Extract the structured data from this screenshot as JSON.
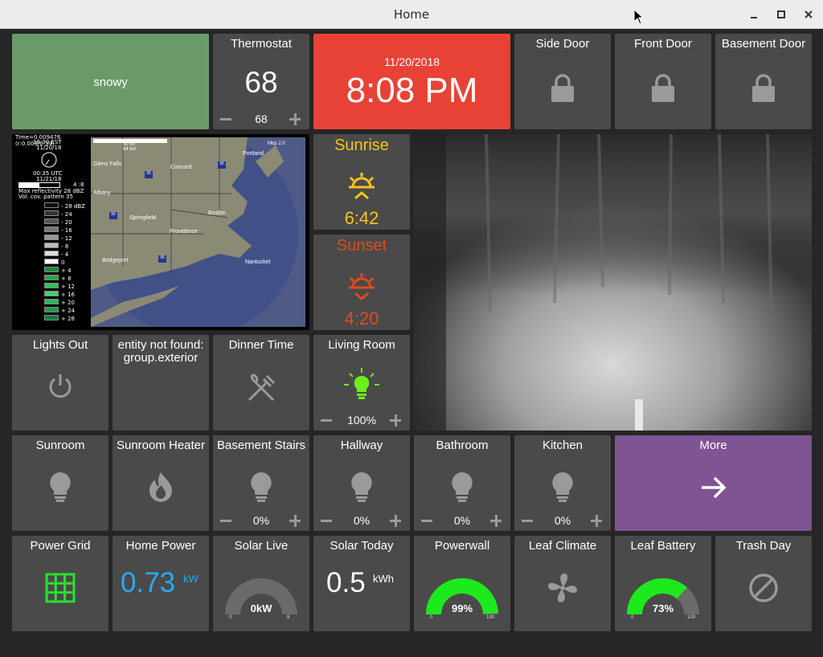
{
  "window": {
    "title": "Home"
  },
  "tiles": {
    "weather": {
      "label": "snowy",
      "color": "#6a9a6a"
    },
    "thermostat": {
      "title": "Thermostat",
      "value": "68",
      "setpoint": "68"
    },
    "clock": {
      "date": "11/20/2018",
      "time": "8:08 PM",
      "color": "#e84236"
    },
    "side_door": {
      "title": "Side Door",
      "icon": "lock-icon"
    },
    "front_door": {
      "title": "Front Door",
      "icon": "lock-icon"
    },
    "basement_door": {
      "title": "Basement Door",
      "icon": "lock-icon"
    },
    "sunrise": {
      "title": "Sunrise",
      "time": "6:42",
      "color": "#f5c518"
    },
    "sunset": {
      "title": "Sunset",
      "time": "4:20",
      "color": "#e04a1e"
    },
    "radar": {
      "time_line": "Time=0.009476 (r:0.003/0.34)",
      "est_time": "18:30 EST",
      "date1": "11/20/18",
      "utc_time": "00:35 UTC",
      "date2": "11/21/18",
      "scale_mid": "4 :8",
      "max_refl": "Max reflectivity 28 dBZ",
      "vol_pattern": "Vol. cov. pattern 35",
      "legend": [
        "- 28 dBZ",
        "- 24",
        "- 20",
        "- 16",
        "- 12",
        "- 8",
        "- 4",
        "0",
        "+ 4",
        "+ 8",
        "+ 12",
        "+ 16",
        "+ 20",
        "+ 24",
        "+ 28"
      ],
      "scale_text_1": "40 mi",
      "scale_text_2": "64 km",
      "cities": [
        "Portland",
        "Glens Falls",
        "Concord",
        "Albany",
        "Boston",
        "Springfield",
        "Providence",
        "Bridgeport",
        "Nantucket"
      ],
      "highways": [
        "95",
        "90",
        "95",
        "95"
      ],
      "map_corner": "Mbp 2.0"
    },
    "lights_out": {
      "title": "Lights Out"
    },
    "entity_error": {
      "title": "entity not found: group.exterior"
    },
    "dinner_time": {
      "title": "Dinner Time"
    },
    "living_room": {
      "title": "Living Room",
      "value": "100%",
      "color": "#6bef1a"
    },
    "sunroom": {
      "title": "Sunroom"
    },
    "sunroom_heater": {
      "title": "Sunroom Heater"
    },
    "basement_stairs": {
      "title": "Basement Stairs",
      "value": "0%"
    },
    "hallway": {
      "title": "Hallway",
      "value": "0%"
    },
    "bathroom": {
      "title": "Bathroom",
      "value": "0%"
    },
    "kitchen": {
      "title": "Kitchen",
      "value": "0%"
    },
    "more": {
      "title": "More",
      "color": "#7e5493"
    },
    "power_grid": {
      "title": "Power Grid",
      "color": "#28e02e"
    },
    "home_power": {
      "title": "Home Power",
      "value": "0.73",
      "unit": "kW",
      "color": "#29a9f3"
    },
    "solar_live": {
      "title": "Solar Live",
      "value": "0kW",
      "min": "0",
      "max": "8",
      "fraction": 0
    },
    "solar_today": {
      "title": "Solar Today",
      "value": "0.5",
      "unit": "kWh"
    },
    "powerwall": {
      "title": "Powerwall",
      "value": "99%",
      "min": "0",
      "max": "100",
      "fraction": 0.99,
      "color": "#1cea1c"
    },
    "leaf_climate": {
      "title": "Leaf Climate",
      "icon": "fan-icon"
    },
    "leaf_battery": {
      "title": "Leaf Battery",
      "value": "73%",
      "min": "0",
      "max": "100",
      "fraction": 0.73,
      "color": "#1cea1c"
    },
    "trash_day": {
      "title": "Trash Day",
      "icon": "block-icon"
    }
  }
}
